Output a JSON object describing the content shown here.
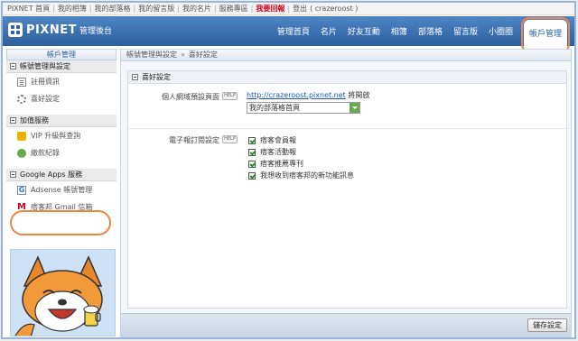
{
  "topbar": {
    "links": [
      "PIXNET 首頁",
      "我的相簿",
      "我的部落格",
      "我的留言版",
      "我的名片",
      "服務專區"
    ],
    "hot_link": "我要回報",
    "logout": "登出",
    "username": "( crazeroost )"
  },
  "header": {
    "logo": "PIXNET",
    "logo_sub": "管理後台",
    "nav": [
      "管理首頁",
      "名片",
      "好友互動",
      "相簿",
      "部落格",
      "留言版",
      "小圈圈"
    ],
    "nav_active": "帳戶管理"
  },
  "sidebar": {
    "title": "帳戶管理",
    "sections": [
      {
        "label": "帳號管理與設定",
        "items": [
          {
            "label": "註冊資訊",
            "icon": "document-icon"
          },
          {
            "label": "喜好設定",
            "icon": "gear-icon"
          }
        ]
      },
      {
        "label": "加值服務",
        "items": [
          {
            "label": "VIP 升級與查詢",
            "icon": "vip-icon"
          },
          {
            "label": "繳款紀錄",
            "icon": "coin-icon"
          }
        ]
      },
      {
        "label": "Google Apps 服務",
        "items": [
          {
            "label": "Adsense 帳號管理",
            "icon": "google-icon"
          },
          {
            "label": "痞客邦 Gmail 信箱",
            "icon": "gmail-icon"
          }
        ]
      }
    ]
  },
  "breadcrumb": {
    "parent": "帳號管理與設定",
    "current": "喜好設定"
  },
  "panel": {
    "title": "喜好設定",
    "homepage": {
      "label": "個人網域預設頁面",
      "help": "HELP",
      "url": "http://crazeroost.pixnet.net",
      "suffix": "將開啟",
      "selected": "我的部落格首頁"
    },
    "subscriptions": {
      "label": "電子報訂閱設定",
      "help": "HELP",
      "options": [
        "痞客會員報",
        "痞客活動報",
        "痞客推薦專刊",
        "我想收到痞客邦的新功能訊息"
      ]
    }
  },
  "footer": {
    "save_label": "儲存設定"
  }
}
